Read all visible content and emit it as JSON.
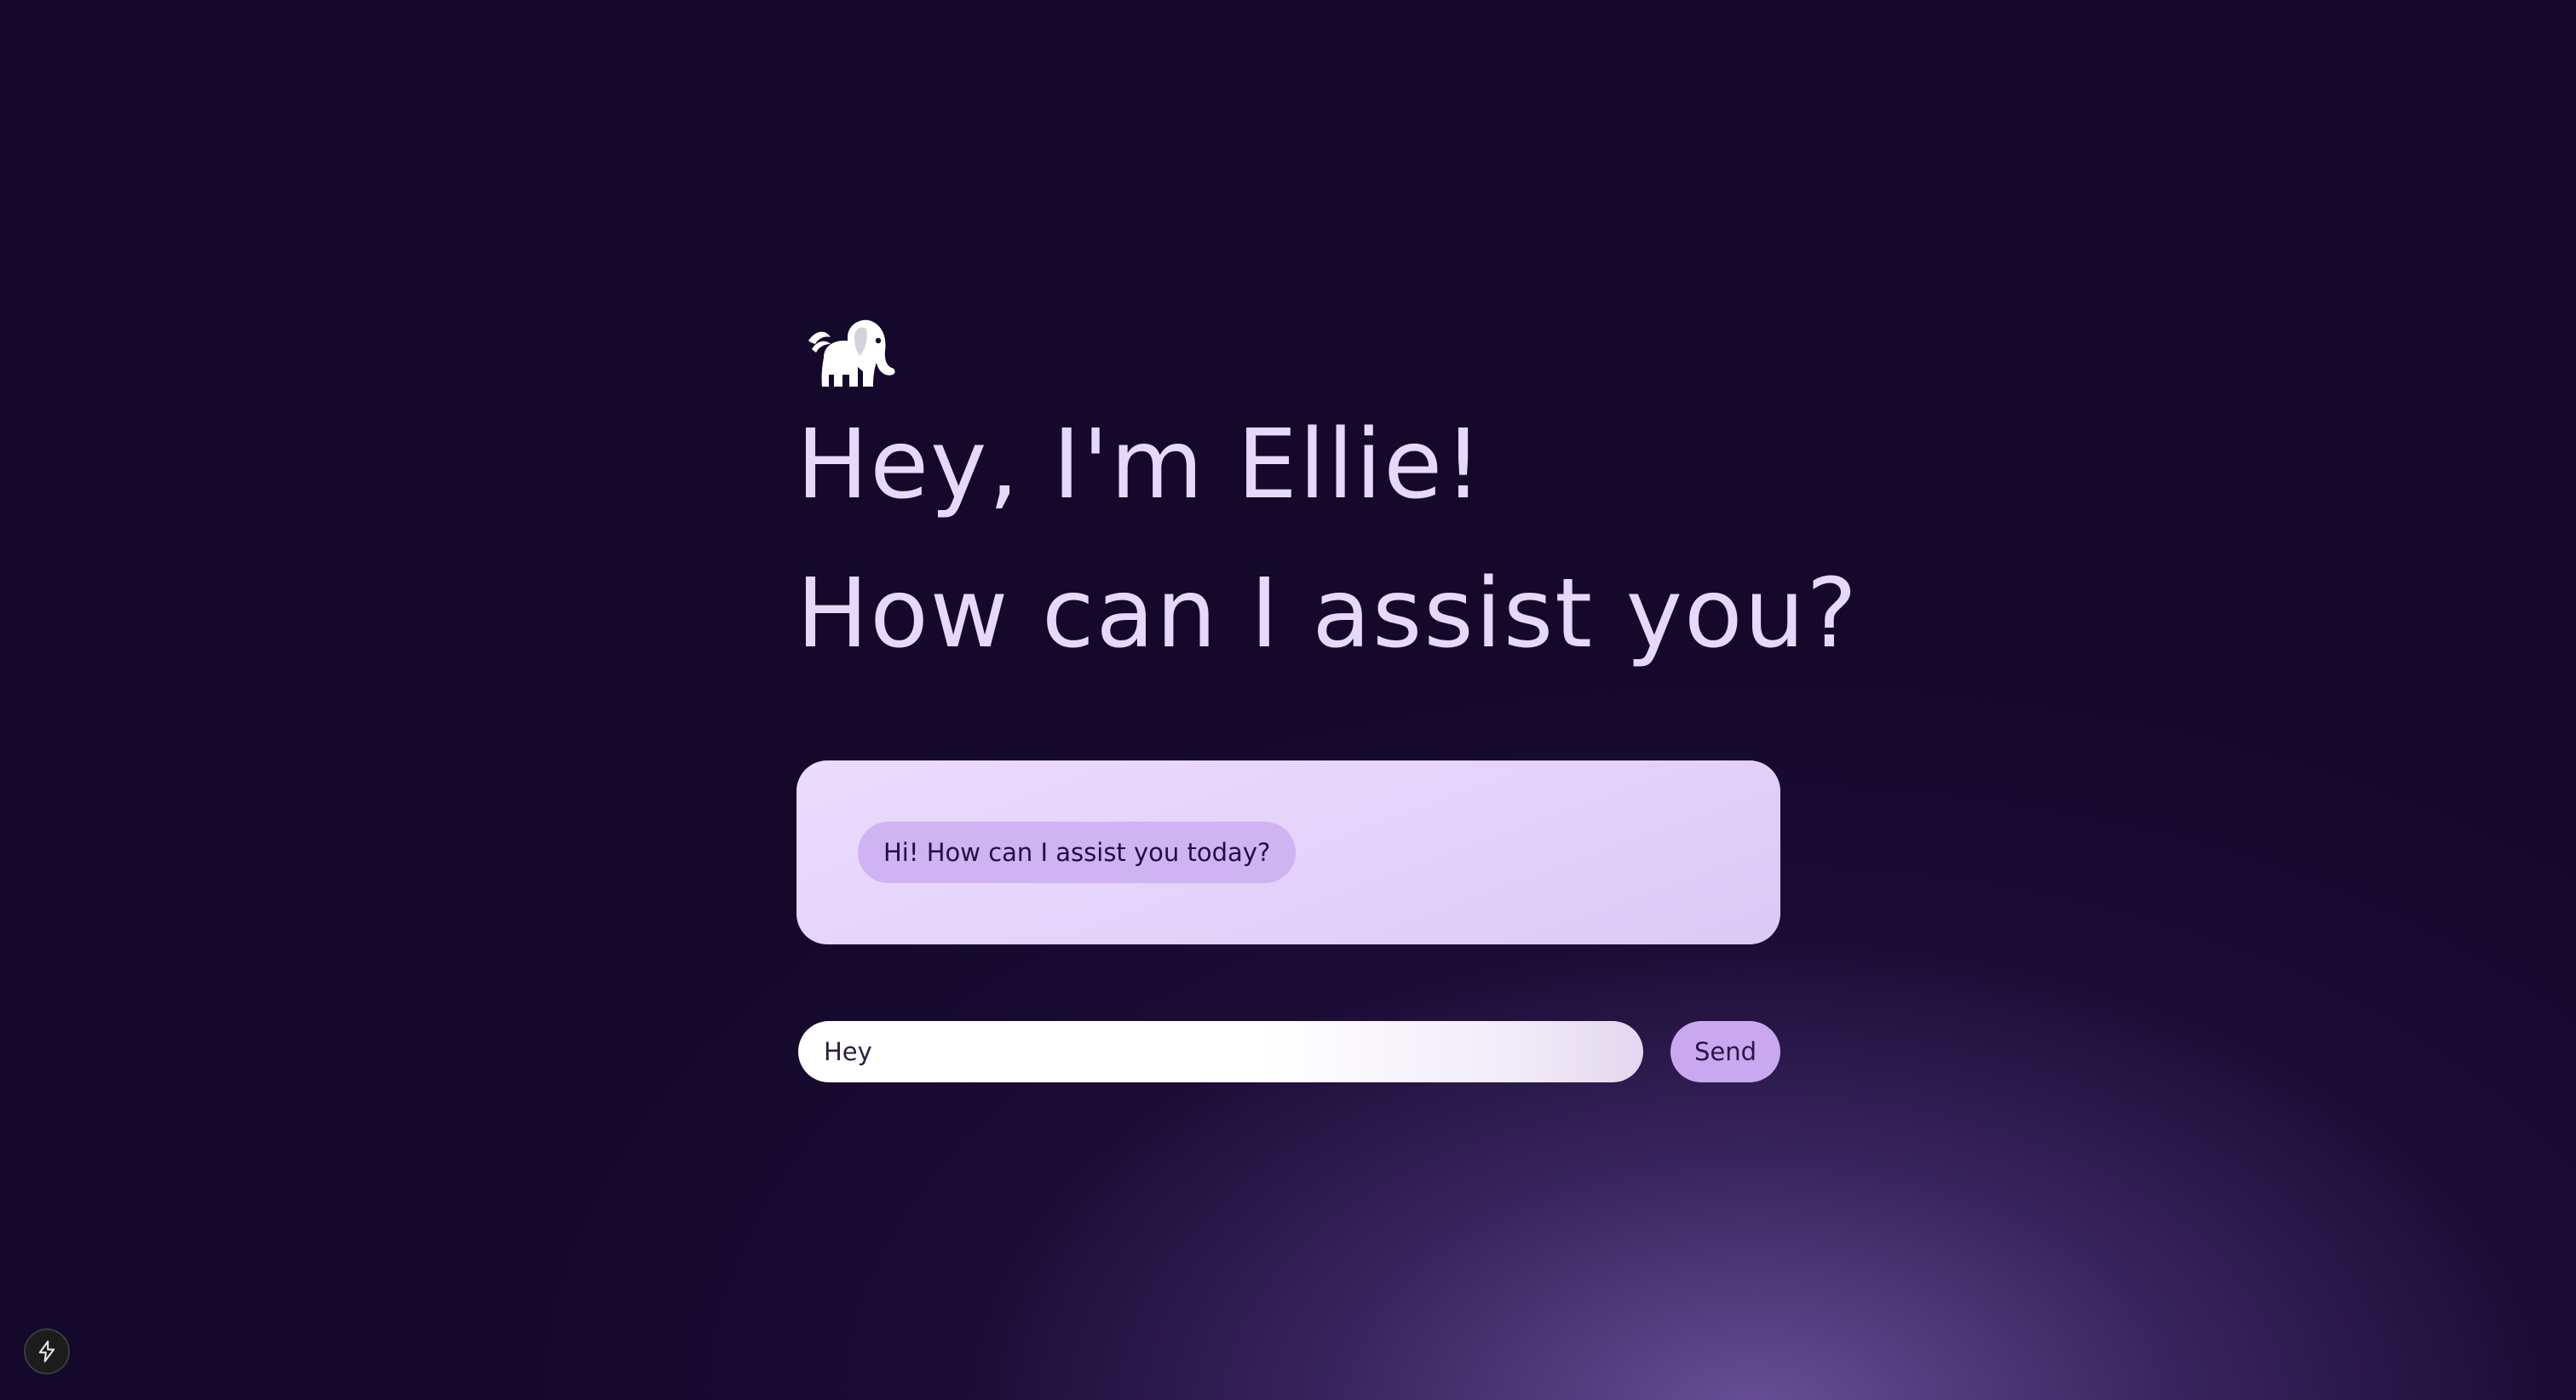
{
  "hero": {
    "logo_icon": "flying-elephant-icon",
    "greeting": "Hey, I'm Ellie!",
    "question": "How can I assist you?"
  },
  "chat": {
    "messages": [
      {
        "role": "assistant",
        "text": "Hi! How can I assist you today?"
      }
    ]
  },
  "composer": {
    "input_value": "Hey",
    "send_label": "Send"
  },
  "dev_indicator": {
    "icon": "lightning-bolt-icon"
  },
  "colors": {
    "background": "#14082b",
    "heading_text": "#e7d8fb",
    "panel": "#e4d2fb",
    "bubble": "#cfb3f2",
    "send_button": "#c9a8f0"
  }
}
